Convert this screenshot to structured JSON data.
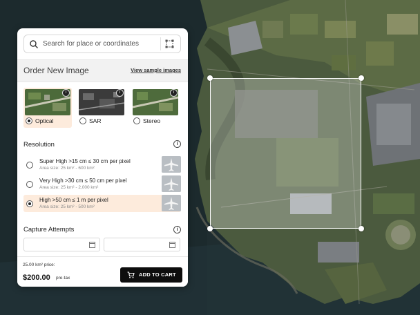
{
  "search": {
    "placeholder": "Search for place or coordinates"
  },
  "order": {
    "title": "Order New Image",
    "sample_link": "View sample images"
  },
  "products": [
    {
      "label": "Optical",
      "selected": true
    },
    {
      "label": "SAR",
      "selected": false
    },
    {
      "label": "Stereo",
      "selected": false
    }
  ],
  "resolution": {
    "title": "Resolution",
    "options": [
      {
        "name": "Super High >15 cm ≤ 30 cm per pixel",
        "area": "Area size: 25 km² - 600 km²",
        "selected": false
      },
      {
        "name": "Very High >30 cm ≤ 50 cm per pixel",
        "area": "Area size: 25 km² - 2,000 km²",
        "selected": false
      },
      {
        "name": "High >50 cm ≤ 1 m per pixel",
        "area": "Area size: 25 km² - 500 km²",
        "selected": true
      }
    ]
  },
  "capture": {
    "title": "Capture Attempts"
  },
  "footer": {
    "price_label": "25.00 km² price:",
    "price": "$200.00",
    "tax": "pre-tax",
    "cart_button": "ADD TO CART"
  },
  "colors": {
    "selected_bg": "#fdebdc",
    "button": "#0d0d0d"
  }
}
